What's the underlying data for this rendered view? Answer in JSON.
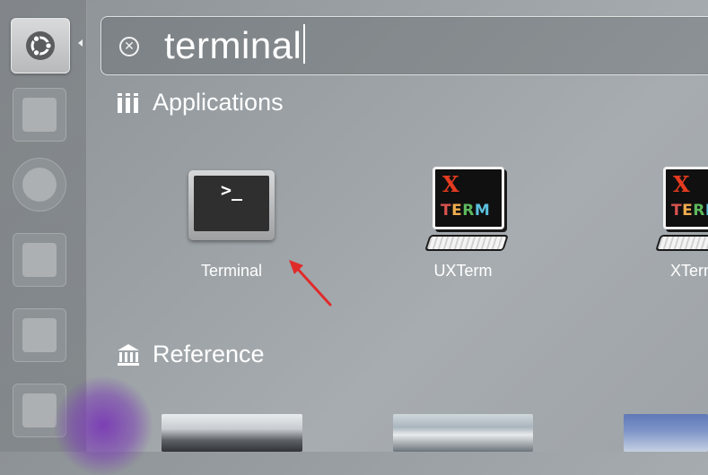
{
  "search": {
    "query": "terminal"
  },
  "sections": {
    "applications": "Applications",
    "reference": "Reference"
  },
  "apps": [
    {
      "label": "Terminal",
      "icon": "terminal-icon"
    },
    {
      "label": "UXTerm",
      "icon": "xterm-icon"
    },
    {
      "label": "XTerm",
      "icon": "xterm-icon"
    }
  ],
  "xterm_icon_text": {
    "x": "X",
    "term": "TERM"
  },
  "terminal_prompt": ">_",
  "colors": {
    "accent_red": "#e02b2b",
    "term_t": "#d9534f",
    "term_e": "#f0ad4e",
    "term_r": "#5cb85c",
    "term_m": "#5bc0de"
  }
}
